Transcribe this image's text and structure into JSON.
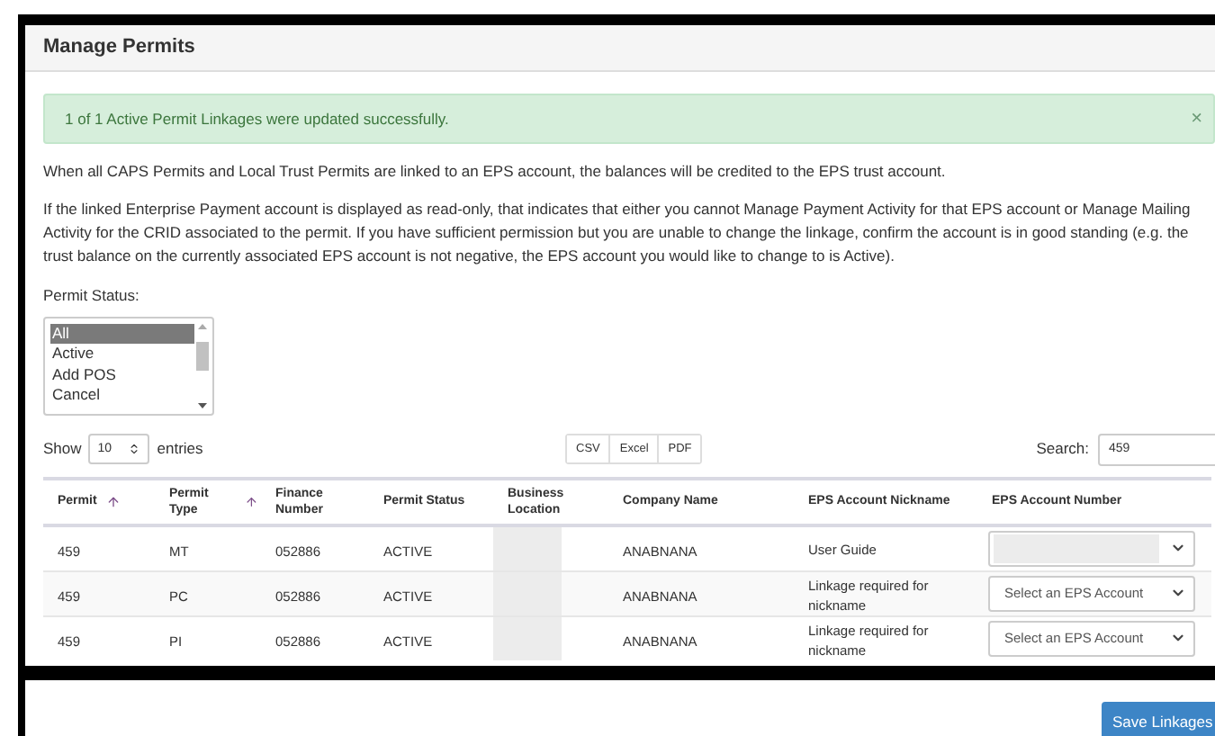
{
  "title": "Manage Permits",
  "alert": {
    "message": "1 of 1 Active Permit Linkages were updated successfully.",
    "close": "×"
  },
  "paragraphs": [
    "When all CAPS Permits and Local Trust Permits are linked to an EPS account, the balances will be credited to the EPS trust account.",
    "If the linked Enterprise Payment account is displayed as read-only, that indicates that either you cannot Manage Payment Activity for that EPS account or Manage Mailing Activity for the CRID associated to the permit. If you have sufficient permission but you are unable to change the linkage, confirm the account is in good standing (e.g. the trust balance on the currently associated EPS account is not negative, the EPS account you would like to change to is Active)."
  ],
  "permit_status": {
    "label": "Permit Status:",
    "options": [
      {
        "label": "All",
        "selected": true
      },
      {
        "label": "Active",
        "selected": false
      },
      {
        "label": "Add POS",
        "selected": false
      },
      {
        "label": "Cancel",
        "selected": false
      }
    ]
  },
  "page_length": {
    "prefix": "Show",
    "value": "10",
    "suffix": "entries"
  },
  "export_buttons": [
    "CSV",
    "Excel",
    "PDF"
  ],
  "search": {
    "label": "Search:",
    "value": "459"
  },
  "table": {
    "columns": [
      {
        "label": "Permit",
        "sortable": true
      },
      {
        "label": "Permit Type",
        "sortable": true
      },
      {
        "label": "Finance Number",
        "sortable": false
      },
      {
        "label": "Permit Status",
        "sortable": false
      },
      {
        "label": "Business Location",
        "sortable": false
      },
      {
        "label": "Company Name",
        "sortable": false
      },
      {
        "label": "EPS Account Nickname",
        "sortable": false
      },
      {
        "label": "EPS Account Number",
        "sortable": false
      }
    ],
    "rows": [
      {
        "permit": "459",
        "type": "MT",
        "finance": "052886",
        "status": "ACTIVE",
        "company": "ANABNANA",
        "nickname": "User Guide",
        "account": {
          "kind": "redacted"
        }
      },
      {
        "permit": "459",
        "type": "PC",
        "finance": "052886",
        "status": "ACTIVE",
        "company": "ANABNANA",
        "nickname": "Linkage required for nickname",
        "account": {
          "kind": "placeholder",
          "text": "Select an EPS Account"
        }
      },
      {
        "permit": "459",
        "type": "PI",
        "finance": "052886",
        "status": "ACTIVE",
        "company": "ANABNANA",
        "nickname": "Linkage required for nickname",
        "account": {
          "kind": "placeholder",
          "text": "Select an EPS Account"
        }
      }
    ]
  },
  "save_button": "Save Linkages"
}
